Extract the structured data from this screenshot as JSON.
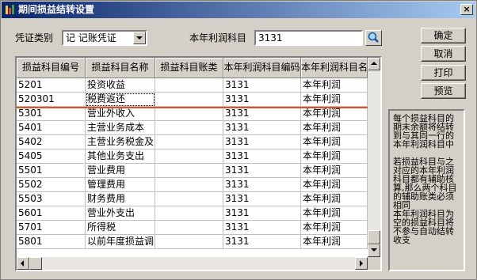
{
  "window": {
    "title": "期间损益结转设置",
    "close_label": "×"
  },
  "form": {
    "voucher_type_label": "凭证类别",
    "voucher_type_value": "记  记账凭证",
    "profit_account_label": "本年利润科目",
    "profit_account_value": "3131"
  },
  "buttons": {
    "ok": "确定",
    "cancel": "取消",
    "print": "打印",
    "preview": "预览"
  },
  "table": {
    "columns": [
      "损益科目编号",
      "损益科目名称",
      "损益科目账类",
      "本年利润科目编码",
      "本年利润科目名称"
    ],
    "header_display": [
      "损益科目编号",
      "损益科目名称",
      "损益科目账类",
      "本年利润科目编码",
      "本年利润科目名称"
    ],
    "rows": [
      [
        "5201",
        "投资收益",
        "",
        "3131",
        "本年利润"
      ],
      [
        "520301",
        "税费返还",
        "",
        "3131",
        "本年利润"
      ],
      [
        "5301",
        "营业外收入",
        "",
        "3131",
        "本年利润"
      ],
      [
        "5401",
        "主营业务成本",
        "",
        "3131",
        "本年利润"
      ],
      [
        "5402",
        "主营业务税金及",
        "",
        "3131",
        "本年利润"
      ],
      [
        "5405",
        "其他业务支出",
        "",
        "3131",
        "本年利润"
      ],
      [
        "5501",
        "营业费用",
        "",
        "3131",
        "本年利润"
      ],
      [
        "5502",
        "管理费用",
        "",
        "3131",
        "本年利润"
      ],
      [
        "5503",
        "财务费用",
        "",
        "3131",
        "本年利润"
      ],
      [
        "5601",
        "营业外支出",
        "",
        "3131",
        "本年利润"
      ],
      [
        "5701",
        "所得税",
        "",
        "3131",
        "本年利润"
      ],
      [
        "5801",
        "以前年度损益调",
        "",
        "3131",
        "本年利润"
      ]
    ],
    "selected_row": 1
  },
  "note": "每个损益科目的期末余额将结转到与其同一行的本年利润科目中\n\n若损益科目与之对应的本年利润科目都有辅助核算,那么两个科目的辅助账类必须相同\n本年利润科目为空的损益科目将不参与自动结转收支",
  "colors": {
    "titlebar": "#0a246a",
    "face": "#d4d0c8",
    "highlight_line": "#e0501e"
  },
  "icons": [
    "app-icon",
    "close-icon",
    "chevron-down-icon",
    "search-icon",
    "arrow-up-icon",
    "arrow-down-icon",
    "arrow-left-icon",
    "arrow-right-icon"
  ]
}
